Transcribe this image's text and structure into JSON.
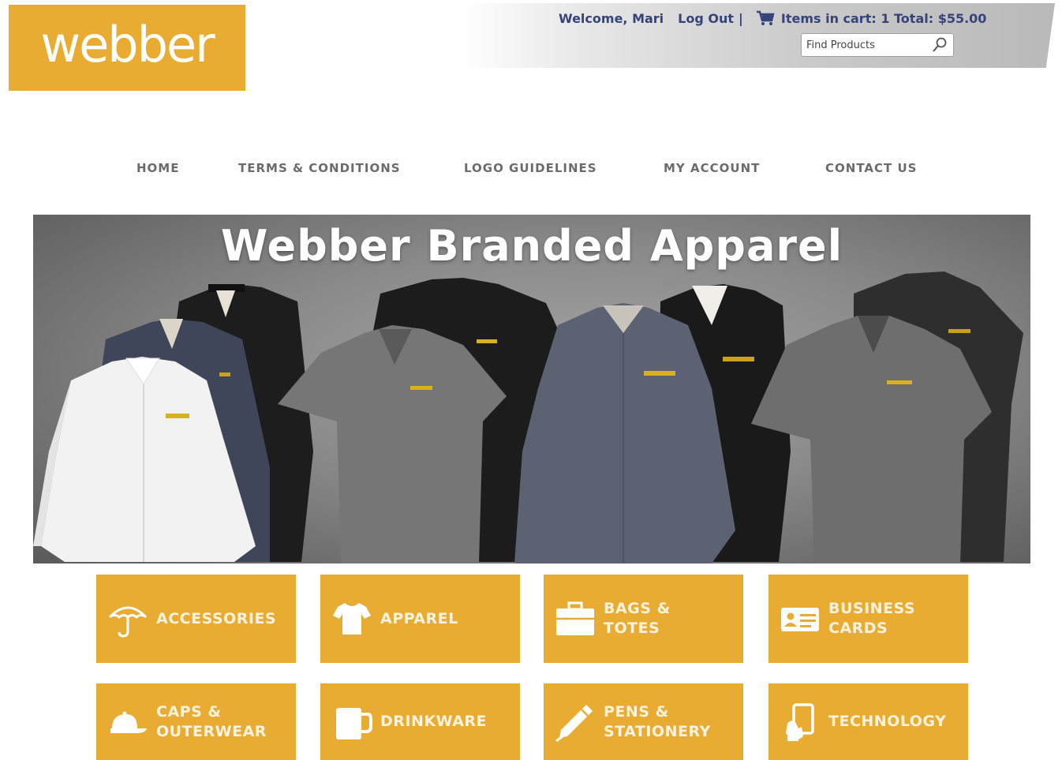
{
  "brand": {
    "logo_text": "webber",
    "accent_color": "#e8ac32"
  },
  "header": {
    "welcome": "Welcome, Mari",
    "logout": "Log Out",
    "separator": "|",
    "cart_icon": "cart-icon",
    "cart_text": "Items in cart: 1 Total: $55.00",
    "search": {
      "placeholder": "Find Products",
      "icon": "search-icon"
    }
  },
  "nav": {
    "items": [
      {
        "label": "HOME"
      },
      {
        "label": "TERMS & CONDITIONS"
      },
      {
        "label": "LOGO GUIDELINES"
      },
      {
        "label": "MY ACCOUNT"
      },
      {
        "label": "CONTACT US"
      }
    ]
  },
  "hero": {
    "title": "Webber Branded Apparel"
  },
  "categories": [
    {
      "label": "ACCESSORIES",
      "icon": "umbrella-icon"
    },
    {
      "label": "APPAREL",
      "icon": "tshirt-icon"
    },
    {
      "label": "BAGS &\nTOTES",
      "icon": "briefcase-icon"
    },
    {
      "label": "BUSINESS\nCARDS",
      "icon": "business-card-icon"
    },
    {
      "label": "CAPS &\nOUTERWEAR",
      "icon": "cap-icon"
    },
    {
      "label": "DRINKWARE",
      "icon": "mug-icon"
    },
    {
      "label": "PENS &\nSTATIONERY",
      "icon": "pen-icon"
    },
    {
      "label": "TECHNOLOGY",
      "icon": "tablet-icon"
    }
  ]
}
